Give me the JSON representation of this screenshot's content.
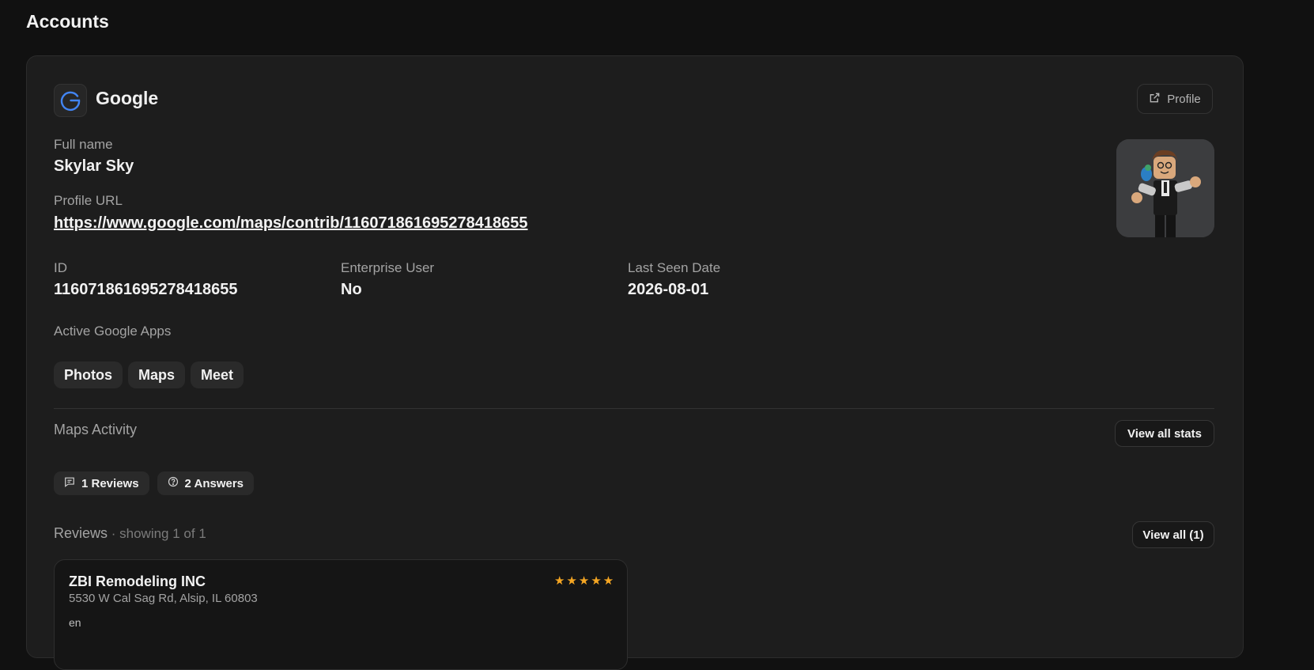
{
  "page": {
    "title": "Accounts"
  },
  "account": {
    "provider": "Google",
    "profile_button": "Profile",
    "full_name_label": "Full name",
    "full_name": "Skylar Sky",
    "profile_url_label": "Profile URL",
    "profile_url": "https://www.google.com/maps/contrib/116071861695278418655",
    "id_label": "ID",
    "id": "116071861695278418655",
    "enterprise_label": "Enterprise User",
    "enterprise": "No",
    "last_seen_label": "Last Seen Date",
    "last_seen": "2026-08-01",
    "apps_label": "Active Google Apps",
    "apps": [
      "Photos",
      "Maps",
      "Meet"
    ]
  },
  "maps_activity": {
    "label": "Maps Activity",
    "view_all_stats": "View all stats",
    "stats": [
      {
        "icon": "message-icon",
        "label": "1 Reviews"
      },
      {
        "icon": "question-circle-icon",
        "label": "2 Answers"
      }
    ]
  },
  "reviews": {
    "title": "Reviews",
    "showing": " · showing 1 of 1",
    "view_all": "View all (1)",
    "items": [
      {
        "business": "ZBI Remodeling INC",
        "address": "5530 W Cal Sag Rd, Alsip, IL 60803",
        "language": "en",
        "stars": "★★★★★",
        "rating": 5
      }
    ]
  },
  "colors": {
    "background": "#111111",
    "card": "#1d1d1d",
    "google_blue": "#4285f4",
    "star": "#f5a623"
  }
}
